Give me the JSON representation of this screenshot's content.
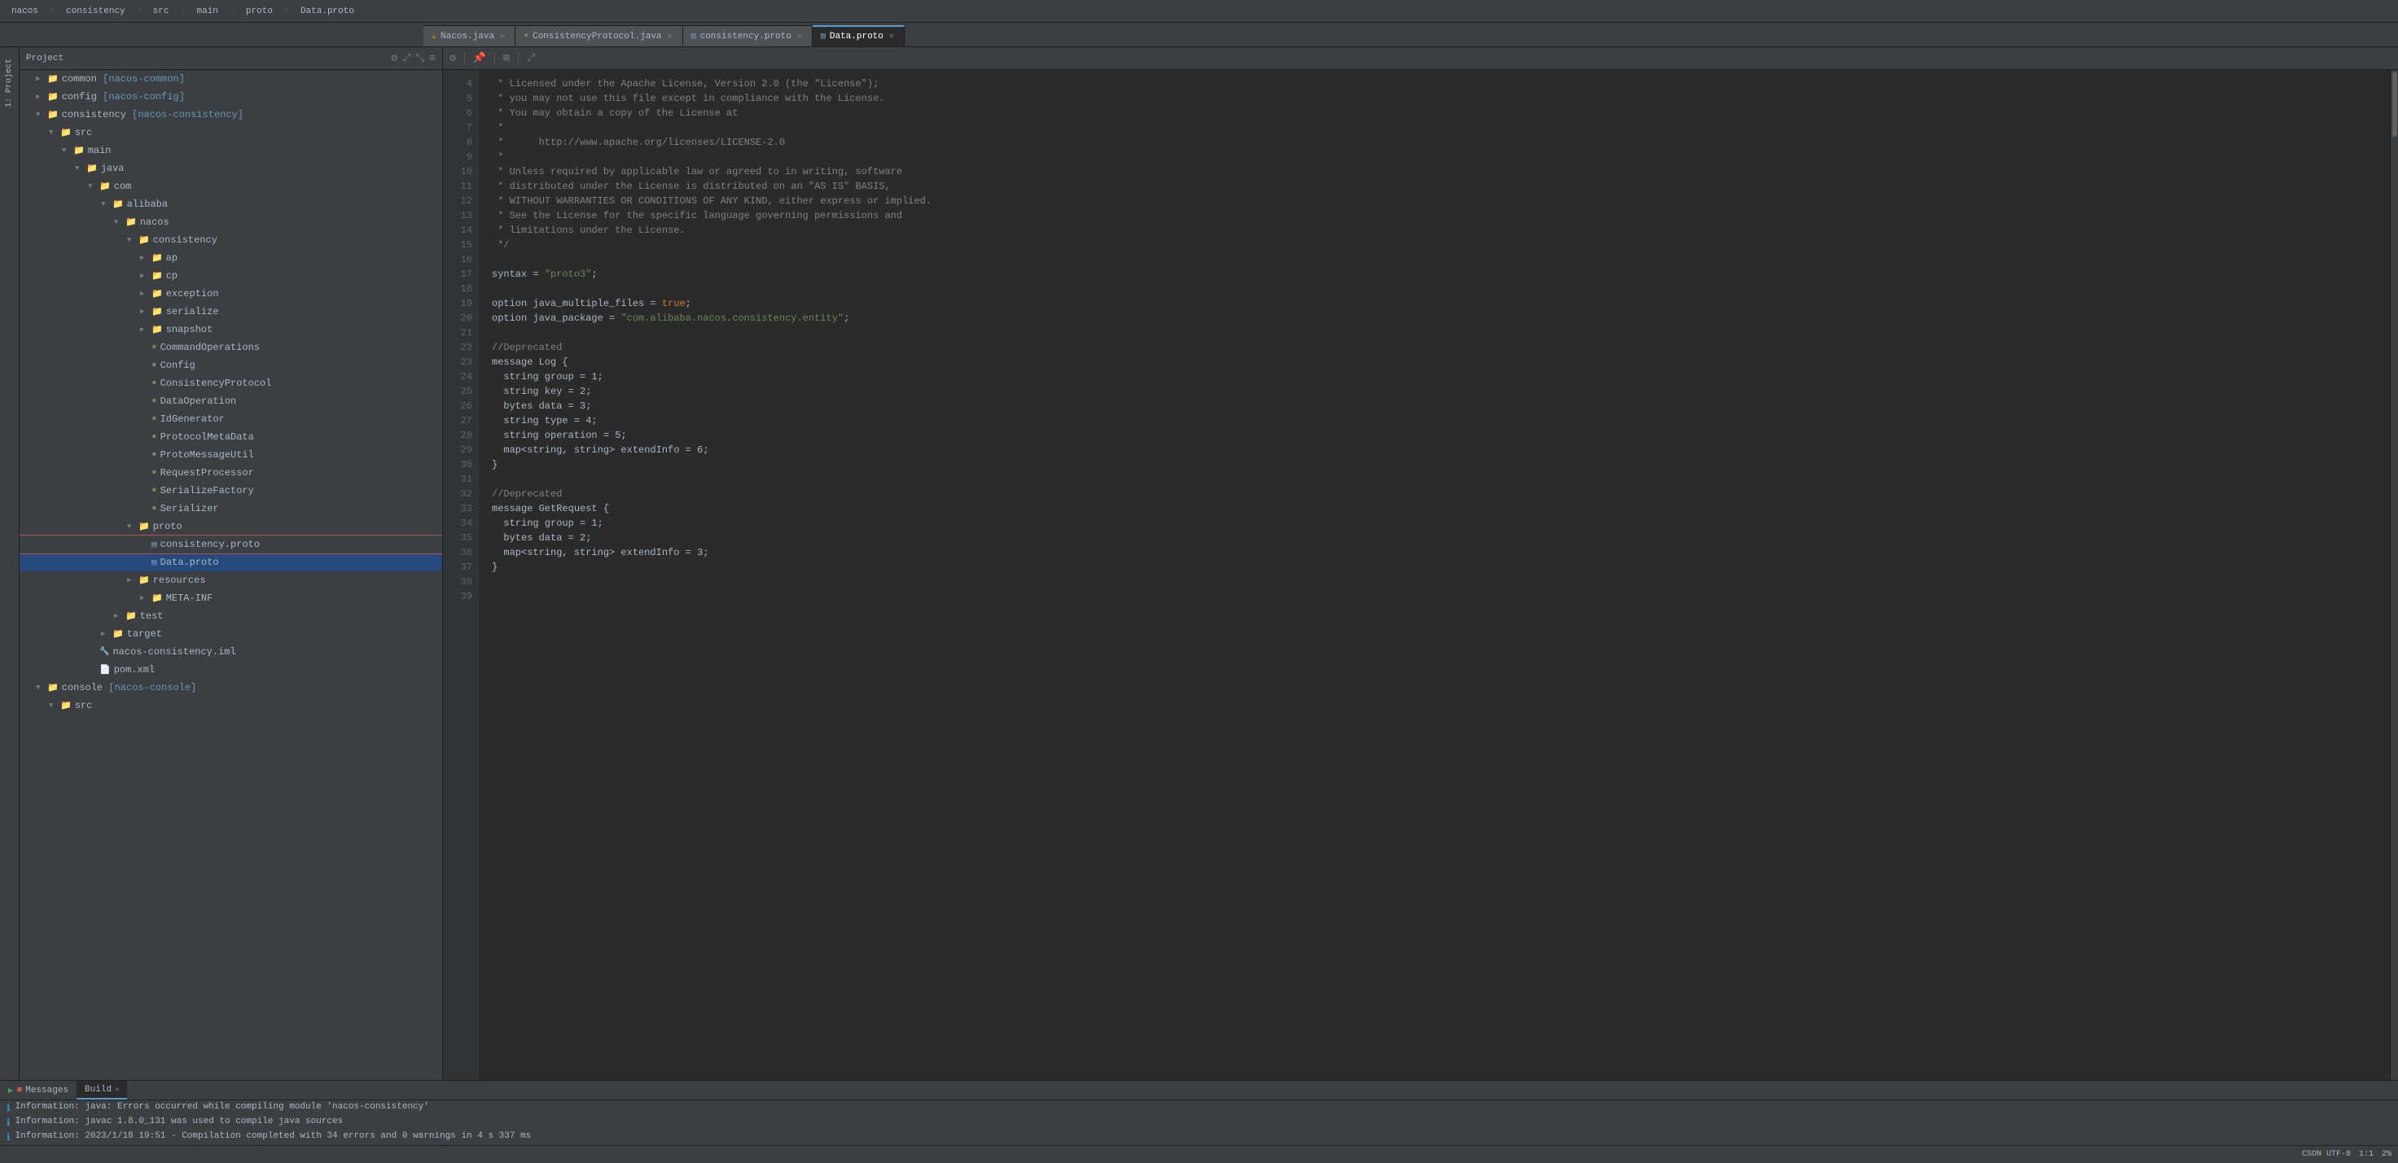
{
  "app": {
    "title": "nacos",
    "tabs_top": [
      "nacos",
      "consistency",
      "src",
      "main",
      "proto",
      "Data.proto"
    ]
  },
  "sidebar": {
    "title": "Project",
    "tree": [
      {
        "id": "common",
        "indent": 1,
        "arrow": "▶",
        "icon": "folder",
        "label": "common",
        "module": "nacos-common",
        "type": "module"
      },
      {
        "id": "config",
        "indent": 1,
        "arrow": "▶",
        "icon": "folder",
        "label": "config",
        "module": "nacos-config",
        "type": "module"
      },
      {
        "id": "consistency",
        "indent": 1,
        "arrow": "▼",
        "icon": "folder",
        "label": "consistency",
        "module": "nacos-consistency",
        "type": "module"
      },
      {
        "id": "src",
        "indent": 2,
        "arrow": "▼",
        "icon": "src",
        "label": "src",
        "type": "src"
      },
      {
        "id": "main",
        "indent": 3,
        "arrow": "▼",
        "icon": "folder",
        "label": "main",
        "type": "folder"
      },
      {
        "id": "java",
        "indent": 4,
        "arrow": "▼",
        "icon": "folder",
        "label": "java",
        "type": "folder"
      },
      {
        "id": "com",
        "indent": 5,
        "arrow": "▼",
        "icon": "folder",
        "label": "com",
        "type": "folder"
      },
      {
        "id": "alibaba",
        "indent": 6,
        "arrow": "▼",
        "icon": "folder",
        "label": "alibaba",
        "type": "folder"
      },
      {
        "id": "nacos",
        "indent": 7,
        "arrow": "▼",
        "icon": "folder",
        "label": "nacos",
        "type": "folder"
      },
      {
        "id": "consistency_pkg",
        "indent": 8,
        "arrow": "▼",
        "icon": "folder",
        "label": "consistency",
        "type": "folder"
      },
      {
        "id": "ap",
        "indent": 9,
        "arrow": "▶",
        "icon": "folder",
        "label": "ap",
        "type": "folder"
      },
      {
        "id": "cp",
        "indent": 9,
        "arrow": "▶",
        "icon": "folder",
        "label": "cp",
        "type": "folder"
      },
      {
        "id": "exception",
        "indent": 9,
        "arrow": "▶",
        "icon": "folder",
        "label": "exception",
        "type": "folder"
      },
      {
        "id": "serialize",
        "indent": 9,
        "arrow": "▶",
        "icon": "folder",
        "label": "serialize",
        "type": "folder"
      },
      {
        "id": "snapshot",
        "indent": 9,
        "arrow": "▶",
        "icon": "folder",
        "label": "snapshot",
        "type": "folder"
      },
      {
        "id": "CommandOperations",
        "indent": 9,
        "arrow": " ",
        "icon": "interface",
        "label": "CommandOperations",
        "type": "interface"
      },
      {
        "id": "Config",
        "indent": 9,
        "arrow": " ",
        "icon": "interface",
        "label": "Config",
        "type": "interface"
      },
      {
        "id": "ConsistencyProtocol",
        "indent": 9,
        "arrow": " ",
        "icon": "interface",
        "label": "ConsistencyProtocol",
        "type": "interface"
      },
      {
        "id": "DataOperation",
        "indent": 9,
        "arrow": " ",
        "icon": "interface",
        "label": "DataOperation",
        "type": "interface"
      },
      {
        "id": "IdGenerator",
        "indent": 9,
        "arrow": " ",
        "icon": "interface",
        "label": "IdGenerator",
        "type": "interface"
      },
      {
        "id": "ProtocolMetaData",
        "indent": 9,
        "arrow": " ",
        "icon": "class",
        "label": "ProtocolMetaData",
        "type": "class"
      },
      {
        "id": "ProtoMessageUtil",
        "indent": 9,
        "arrow": " ",
        "icon": "class",
        "label": "ProtoMessageUtil",
        "type": "class"
      },
      {
        "id": "RequestProcessor",
        "indent": 9,
        "arrow": " ",
        "icon": "interface",
        "label": "RequestProcessor",
        "type": "interface"
      },
      {
        "id": "SerializeFactory",
        "indent": 9,
        "arrow": " ",
        "icon": "interface",
        "label": "SerializeFactory",
        "type": "interface"
      },
      {
        "id": "Serializer",
        "indent": 9,
        "arrow": " ",
        "icon": "interface",
        "label": "Serializer",
        "type": "interface"
      },
      {
        "id": "proto_folder",
        "indent": 8,
        "arrow": "▼",
        "icon": "folder",
        "label": "proto",
        "type": "folder"
      },
      {
        "id": "consistency_proto",
        "indent": 9,
        "arrow": " ",
        "icon": "proto",
        "label": "consistency.proto",
        "type": "proto",
        "selected": true
      },
      {
        "id": "data_proto",
        "indent": 9,
        "arrow": " ",
        "icon": "proto",
        "label": "Data.proto",
        "type": "proto",
        "highlighted": true
      },
      {
        "id": "resources",
        "indent": 8,
        "arrow": "▶",
        "icon": "folder",
        "label": "resources",
        "type": "folder"
      },
      {
        "id": "meta_inf",
        "indent": 9,
        "arrow": "▶",
        "icon": "folder",
        "label": "META-INF",
        "type": "folder"
      },
      {
        "id": "test",
        "indent": 7,
        "arrow": "▶",
        "icon": "folder",
        "label": "test",
        "type": "folder"
      },
      {
        "id": "target",
        "indent": 6,
        "arrow": "▶",
        "icon": "folder",
        "label": "target",
        "type": "folder"
      },
      {
        "id": "nacos_iml",
        "indent": 5,
        "arrow": " ",
        "icon": "iml",
        "label": "nacos-consistency.iml",
        "type": "iml"
      },
      {
        "id": "pom_xml",
        "indent": 5,
        "arrow": " ",
        "icon": "pom",
        "label": "pom.xml",
        "type": "xml"
      },
      {
        "id": "console",
        "indent": 1,
        "arrow": "▼",
        "icon": "folder",
        "label": "console",
        "module": "nacos-console",
        "type": "module"
      },
      {
        "id": "console_src",
        "indent": 2,
        "arrow": "▼",
        "icon": "src",
        "label": "src",
        "type": "src"
      }
    ]
  },
  "editor_tabs": [
    {
      "label": "Nacos.java",
      "icon": "java",
      "active": false,
      "closeable": true
    },
    {
      "label": "ConsistencyProtocol.java",
      "icon": "java-green",
      "active": false,
      "closeable": true
    },
    {
      "label": "consistency.proto",
      "icon": "proto",
      "active": false,
      "closeable": true
    },
    {
      "label": "Data.proto",
      "icon": "proto",
      "active": true,
      "closeable": true
    }
  ],
  "code": {
    "lines": [
      {
        "num": 4,
        "tokens": [
          {
            "t": "comment",
            "v": " * Licensed under the Apache License, Version 2.0 (the \"License\");"
          }
        ]
      },
      {
        "num": 5,
        "tokens": [
          {
            "t": "comment",
            "v": " * you may not use this file except in compliance with the License."
          }
        ]
      },
      {
        "num": 6,
        "tokens": [
          {
            "t": "comment",
            "v": " * You may obtain a copy of the License at"
          }
        ]
      },
      {
        "num": 7,
        "tokens": [
          {
            "t": "comment",
            "v": " *"
          }
        ]
      },
      {
        "num": 8,
        "tokens": [
          {
            "t": "comment",
            "v": " *      http://www.apache.org/licenses/LICENSE-2.0"
          }
        ]
      },
      {
        "num": 9,
        "tokens": [
          {
            "t": "comment",
            "v": " *"
          }
        ]
      },
      {
        "num": 10,
        "tokens": [
          {
            "t": "comment",
            "v": " * Unless required by applicable law or agreed to in writing, software"
          }
        ]
      },
      {
        "num": 11,
        "tokens": [
          {
            "t": "comment",
            "v": " * distributed under the License is distributed on an \"AS IS\" BASIS,"
          }
        ]
      },
      {
        "num": 12,
        "tokens": [
          {
            "t": "comment",
            "v": " * WITHOUT WARRANTIES OR CONDITIONS OF ANY KIND, either express or implied."
          }
        ]
      },
      {
        "num": 13,
        "tokens": [
          {
            "t": "comment",
            "v": " * See the License for the specific language governing permissions and"
          }
        ]
      },
      {
        "num": 14,
        "tokens": [
          {
            "t": "comment",
            "v": " * limitations under the License."
          }
        ]
      },
      {
        "num": 15,
        "tokens": [
          {
            "t": "comment",
            "v": " */"
          }
        ]
      },
      {
        "num": 16,
        "tokens": [
          {
            "t": "plain",
            "v": ""
          }
        ]
      },
      {
        "num": 17,
        "tokens": [
          {
            "t": "plain",
            "v": "syntax = "
          },
          {
            "t": "string",
            "v": "\"proto3\""
          },
          {
            "t": "plain",
            "v": ";"
          }
        ]
      },
      {
        "num": 18,
        "tokens": [
          {
            "t": "plain",
            "v": ""
          }
        ]
      },
      {
        "num": 19,
        "tokens": [
          {
            "t": "plain",
            "v": "option java_multiple_files = "
          },
          {
            "t": "keyword",
            "v": "true"
          },
          {
            "t": "plain",
            "v": ";"
          }
        ]
      },
      {
        "num": 20,
        "tokens": [
          {
            "t": "plain",
            "v": "option java_package = "
          },
          {
            "t": "string",
            "v": "\"com.alibaba.nacos.consistency.entity\""
          },
          {
            "t": "plain",
            "v": ";"
          }
        ]
      },
      {
        "num": 21,
        "tokens": [
          {
            "t": "plain",
            "v": ""
          }
        ]
      },
      {
        "num": 22,
        "tokens": [
          {
            "t": "comment",
            "v": "//Deprecated"
          }
        ]
      },
      {
        "num": 23,
        "tokens": [
          {
            "t": "plain",
            "v": "message Log {"
          }
        ]
      },
      {
        "num": 24,
        "tokens": [
          {
            "t": "plain",
            "v": "  string group = 1;"
          }
        ]
      },
      {
        "num": 25,
        "tokens": [
          {
            "t": "plain",
            "v": "  string key = 2;"
          }
        ]
      },
      {
        "num": 26,
        "tokens": [
          {
            "t": "plain",
            "v": "  bytes data = 3;"
          }
        ]
      },
      {
        "num": 27,
        "tokens": [
          {
            "t": "plain",
            "v": "  string type = 4;"
          }
        ]
      },
      {
        "num": 28,
        "tokens": [
          {
            "t": "plain",
            "v": "  string operation = 5;"
          }
        ]
      },
      {
        "num": 29,
        "tokens": [
          {
            "t": "plain",
            "v": "  map<string, string> extendInfo = 6;"
          }
        ]
      },
      {
        "num": 30,
        "tokens": [
          {
            "t": "plain",
            "v": "}"
          }
        ]
      },
      {
        "num": 31,
        "tokens": [
          {
            "t": "plain",
            "v": ""
          }
        ]
      },
      {
        "num": 32,
        "tokens": [
          {
            "t": "comment",
            "v": "//Deprecated"
          }
        ]
      },
      {
        "num": 33,
        "tokens": [
          {
            "t": "plain",
            "v": "message GetRequest {"
          }
        ]
      },
      {
        "num": 34,
        "tokens": [
          {
            "t": "plain",
            "v": "  string group = 1;"
          }
        ]
      },
      {
        "num": 35,
        "tokens": [
          {
            "t": "plain",
            "v": "  bytes data = 2;"
          }
        ]
      },
      {
        "num": 36,
        "tokens": [
          {
            "t": "plain",
            "v": "  map<string, string> extendInfo = 3;"
          }
        ]
      },
      {
        "num": 37,
        "tokens": [
          {
            "t": "plain",
            "v": "}"
          }
        ]
      },
      {
        "num": 38,
        "tokens": [
          {
            "t": "plain",
            "v": ""
          }
        ]
      },
      {
        "num": 39,
        "tokens": [
          {
            "t": "plain",
            "v": ""
          }
        ]
      }
    ]
  },
  "messages": {
    "tab_label": "Messages",
    "build_label": "Build",
    "lines": [
      {
        "icon": "info",
        "text": "Information: java: Errors occurred while compiling module 'nacos-consistency'"
      },
      {
        "icon": "info",
        "text": "Information: javac 1.8.0_131 was used to compile java sources"
      },
      {
        "icon": "info",
        "text": "Information: 2023/1/18 19:51 - Compilation completed with 34 errors and 0 warnings in 4 s 337 ms"
      }
    ]
  },
  "status_bar": {
    "right_items": [
      "CSON UTF-8",
      "1:1",
      "2%"
    ]
  }
}
